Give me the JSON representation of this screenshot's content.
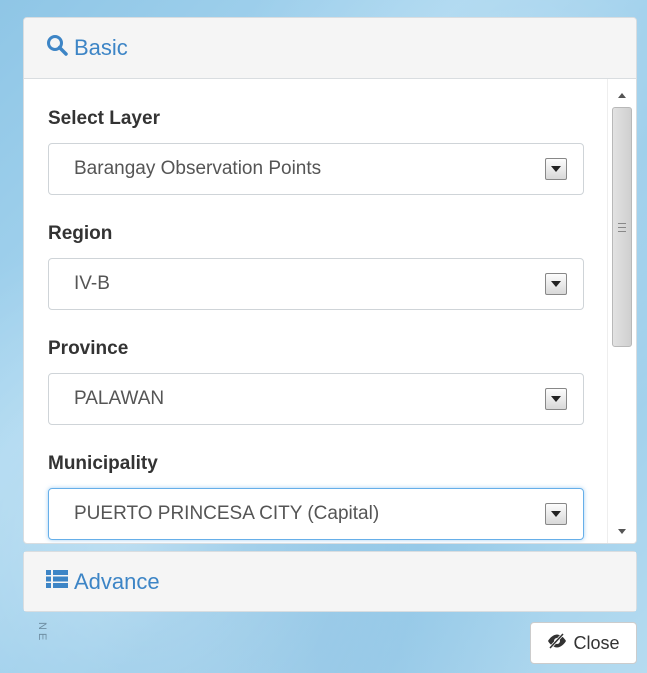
{
  "basic_panel": {
    "title": "Basic",
    "icon": "search-icon"
  },
  "fields": [
    {
      "label": "Select Layer",
      "value": "Barangay Observation Points"
    },
    {
      "label": "Region",
      "value": "IV-B"
    },
    {
      "label": "Province",
      "value": "PALAWAN"
    },
    {
      "label": "Municipality",
      "value": "PUERTO PRINCESA CITY (Capital)"
    }
  ],
  "advance_panel": {
    "title": "Advance",
    "icon": "list-icon"
  },
  "close_button": {
    "label": "Close",
    "icon": "eye-slash-icon"
  },
  "map_label": "N E",
  "colors": {
    "accent": "#3d85c6",
    "focus": "#66afe9",
    "map_water": "#a7d5ef"
  }
}
